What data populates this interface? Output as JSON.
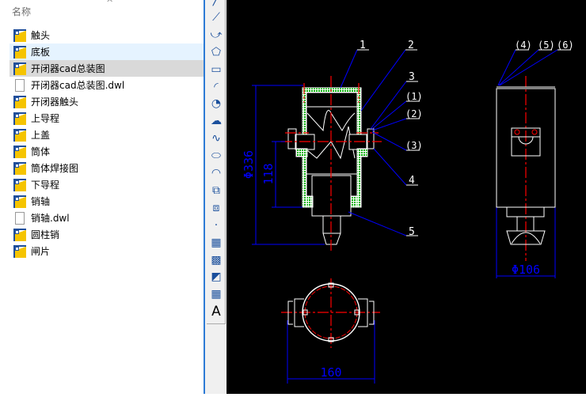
{
  "file_list": {
    "column_header": "名称",
    "items": [
      {
        "name": "触头",
        "type": "cad"
      },
      {
        "name": "底板",
        "type": "cad",
        "state": "hover"
      },
      {
        "name": "开闭器cad总装图",
        "type": "cad",
        "state": "selected"
      },
      {
        "name": "开闭器cad总装图.dwl",
        "type": "doc"
      },
      {
        "name": "开闭器触头",
        "type": "cad"
      },
      {
        "name": "上导程",
        "type": "cad"
      },
      {
        "name": "上盖",
        "type": "cad"
      },
      {
        "name": "筒体",
        "type": "cad"
      },
      {
        "name": "筒体焊接图",
        "type": "cad"
      },
      {
        "name": "下导程",
        "type": "cad"
      },
      {
        "name": "销轴",
        "type": "cad"
      },
      {
        "name": "销轴.dwl",
        "type": "doc"
      },
      {
        "name": "圆柱销",
        "type": "cad"
      },
      {
        "name": "闸片",
        "type": "cad"
      }
    ]
  },
  "toolbar": {
    "tools": [
      "line-icon",
      "construction-line-icon",
      "polyline-icon",
      "polygon-icon",
      "rectangle-icon",
      "arc-icon",
      "circle-icon",
      "revision-cloud-icon",
      "spline-icon",
      "ellipse-icon",
      "ellipse-arc-icon",
      "insert-block-icon",
      "make-block-icon",
      "point-icon",
      "hatch-icon",
      "gradient-icon",
      "region-icon",
      "table-icon",
      "text-icon"
    ],
    "text_glyph": "A"
  },
  "drawing": {
    "labels": [
      "1",
      "2",
      "3",
      "(1)",
      "(2)",
      "(3)",
      "4",
      "5",
      "(4)",
      "(5)",
      "(6)"
    ],
    "dimensions": {
      "overall_height": "Φ336",
      "center_height": "118",
      "side_width": "Φ106",
      "bottom_width": "160"
    },
    "colors": {
      "outline": "#ffffff",
      "center": "#ff0000",
      "dim": "#0000ff",
      "hatch": "#00c000"
    }
  }
}
